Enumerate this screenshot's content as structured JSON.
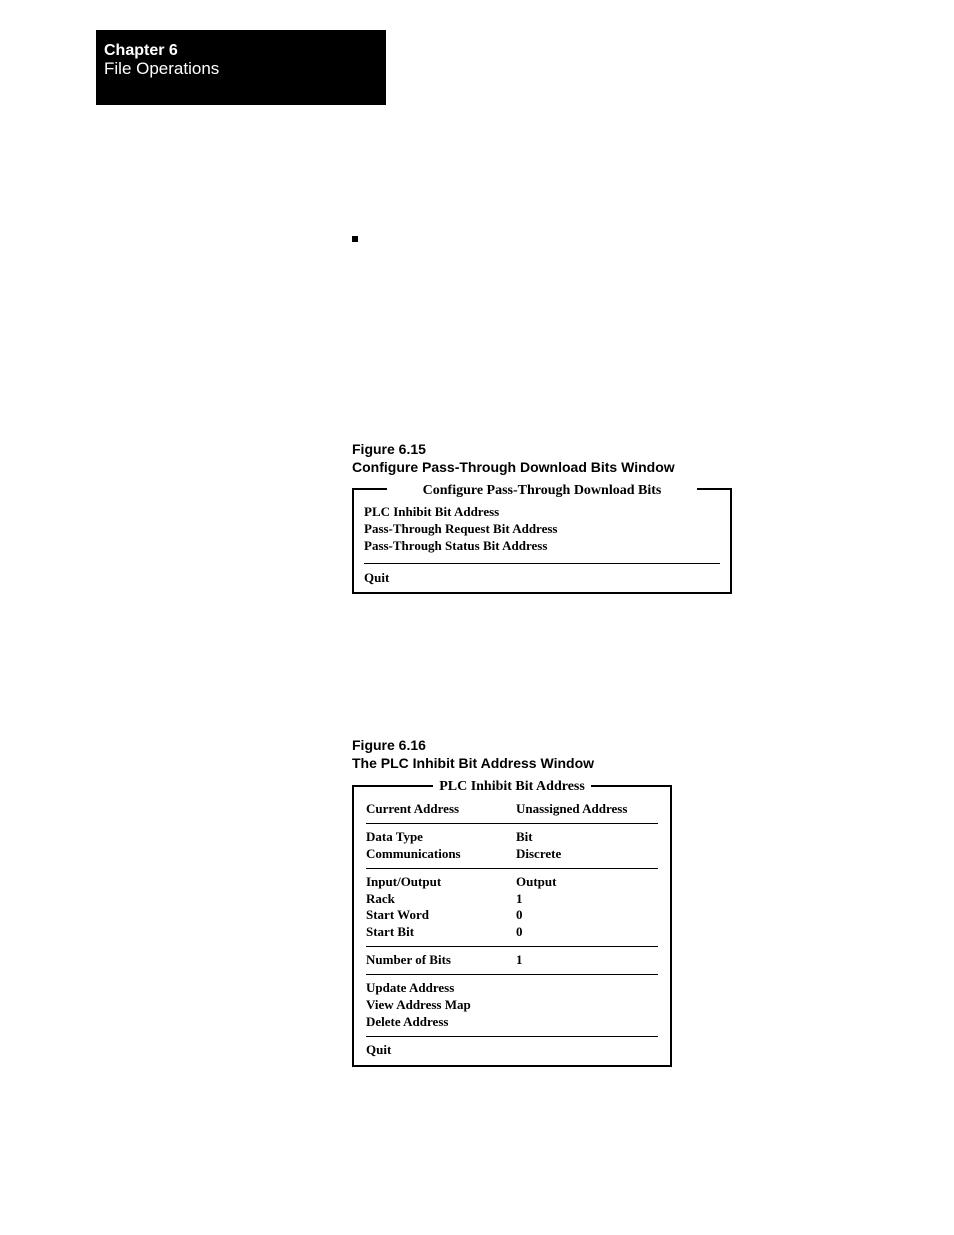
{
  "header": {
    "chapter": "Chapter 6",
    "title": "File Operations"
  },
  "figures": {
    "f615_num": "Figure 6.15",
    "f615_title": "Configure Pass-Through Download Bits Window",
    "f616_num": "Figure 6.16",
    "f616_title": "The PLC Inhibit Bit Address Window"
  },
  "win1": {
    "title": "Configure Pass-Through Download Bits",
    "items": [
      "PLC Inhibit Bit Address",
      "Pass-Through Request Bit Address",
      "Pass-Through Status Bit Address"
    ],
    "quit": "Quit"
  },
  "win2": {
    "title": "PLC Inhibit Bit Address",
    "rows": {
      "current_address_l": "Current Address",
      "current_address_v": "Unassigned Address",
      "data_type_l": "Data Type",
      "data_type_v": "Bit",
      "comm_l": "Communications",
      "comm_v": "Discrete",
      "io_l": "Input/Output",
      "io_v": "Output",
      "rack_l": "Rack",
      "rack_v": "1",
      "start_word_l": "Start Word",
      "start_word_v": "0",
      "start_bit_l": "Start Bit",
      "start_bit_v": "0",
      "num_bits_l": "Number of Bits",
      "num_bits_v": "1",
      "update_addr": "Update Address",
      "view_map": "View Address Map",
      "delete_addr": "Delete Address",
      "quit": "Quit"
    }
  }
}
